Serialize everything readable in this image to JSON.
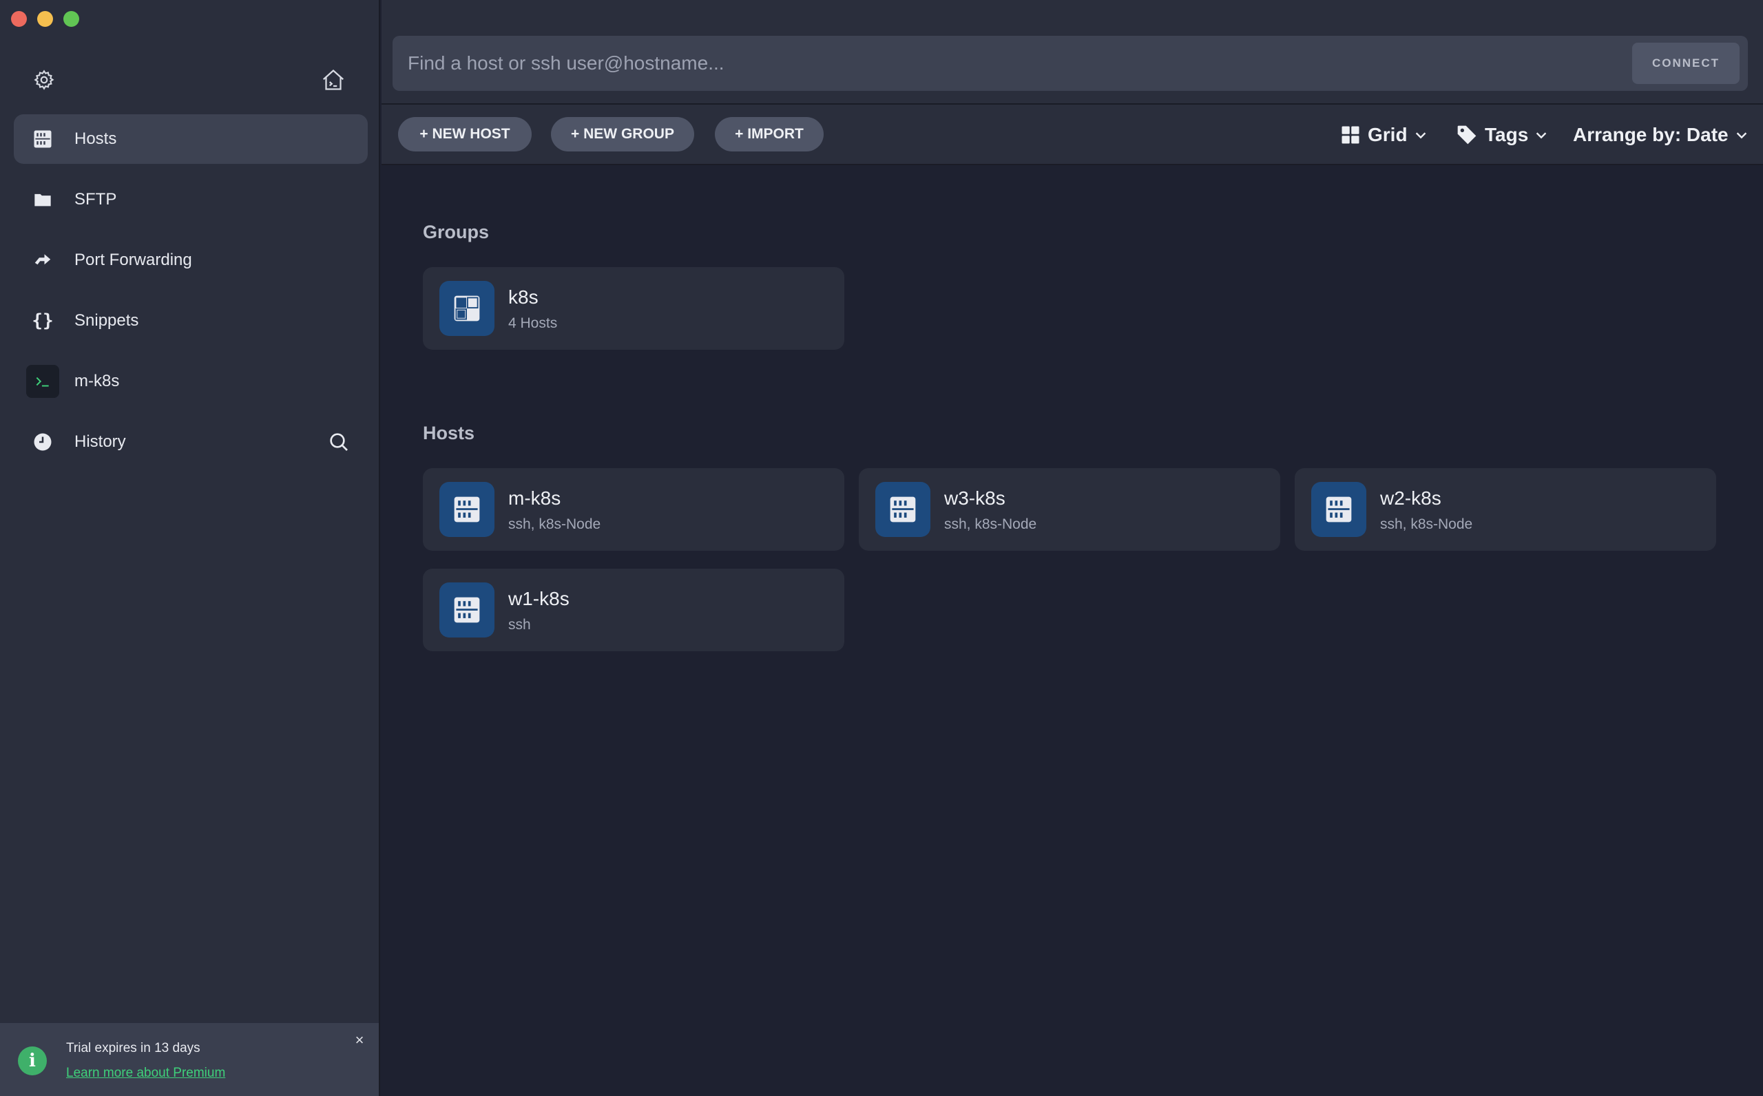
{
  "window": {
    "traffic_lights": [
      "close",
      "minimize",
      "zoom"
    ]
  },
  "sidebar": {
    "top_icons": [
      "gear-icon",
      "home-terminal-icon"
    ],
    "items": [
      {
        "label": "Hosts",
        "icon": "hosts-icon",
        "active": true
      },
      {
        "label": "SFTP",
        "icon": "folder-icon",
        "active": false
      },
      {
        "label": "Port Forwarding",
        "icon": "port-forward-icon",
        "active": false
      },
      {
        "label": "Snippets",
        "icon": "braces-icon",
        "active": false
      },
      {
        "label": "m-k8s",
        "icon": "terminal-icon",
        "active": false
      },
      {
        "label": "History",
        "icon": "clock-icon",
        "active": false
      }
    ],
    "trial": {
      "text": "Trial expires in 13 days",
      "link": "Learn more about Premium",
      "close": "×"
    }
  },
  "search": {
    "placeholder": "Find a host or ssh user@hostname...",
    "value": "",
    "connect_label": "CONNECT"
  },
  "toolbar": {
    "new_host": "+ NEW HOST",
    "new_group": "+ NEW GROUP",
    "import": "+ IMPORT",
    "view": "Grid",
    "tags": "Tags",
    "arrange": "Arrange by: Date"
  },
  "groups": {
    "title": "Groups",
    "items": [
      {
        "name": "k8s",
        "sub": "4 Hosts"
      }
    ]
  },
  "hosts": {
    "title": "Hosts",
    "items": [
      {
        "name": "m-k8s",
        "sub": "ssh, k8s-Node"
      },
      {
        "name": "w3-k8s",
        "sub": "ssh, k8s-Node"
      },
      {
        "name": "w2-k8s",
        "sub": "ssh, k8s-Node"
      },
      {
        "name": "w1-k8s",
        "sub": "ssh"
      }
    ]
  },
  "colors": {
    "sidebar_bg": "#2a2e3c",
    "main_bg": "#1e2130",
    "active_item": "#3d4252",
    "card_icon_bg": "#1d4a7e",
    "accent_green": "#3fd07a"
  }
}
